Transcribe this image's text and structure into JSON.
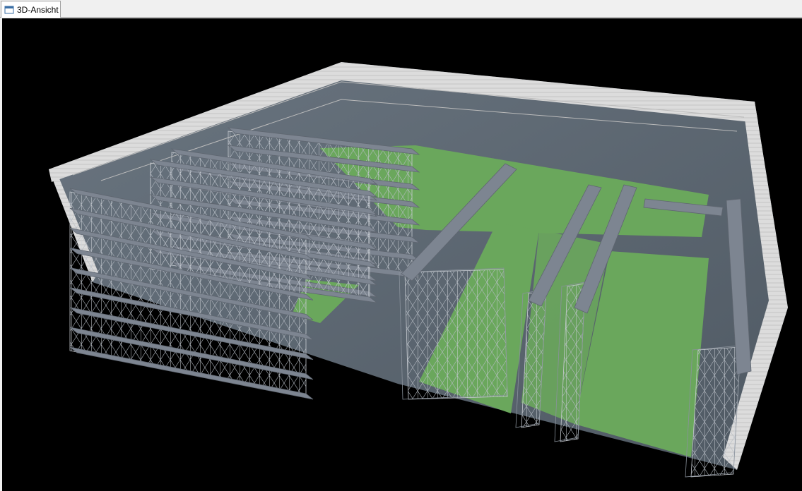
{
  "window": {
    "tab_label": "3D-Ansicht",
    "tab_icon": "window-icon"
  },
  "scene": {
    "background_color": "#000000",
    "floor_color": "#6aa75c",
    "aisle_color": "#5f6a75",
    "wall_color": "#d9d9d9",
    "rack_frame_color": "#c8ccd2",
    "rack_beam_color": "#7d8591"
  }
}
